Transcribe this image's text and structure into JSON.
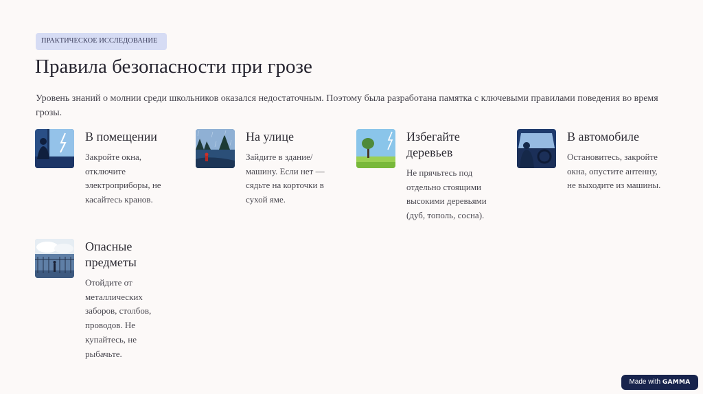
{
  "badge": "ПРАКТИЧЕСКОЕ ИССЛЕДОВАНИЕ",
  "title": "Правила безопасности при грозе",
  "intro": "Уровень знаний о молнии среди школьников оказался недостаточным. Поэтому была разработана памятка с ключевыми правилами поведения во время грозы.",
  "cards": [
    {
      "title": "В помещении",
      "text": "Закройте окна, отключите электроприборы, не касайтесь кранов.",
      "icon": "person-at-window-lightning-icon"
    },
    {
      "title": "На улице",
      "text": "Зайдите в здание/машину. Если нет — сядьте на корточки в сухой яме.",
      "icon": "person-outdoors-rain-icon"
    },
    {
      "title": "Избегайте деревьев",
      "text": "Не прячьтесь под отдельно стоящими высокими деревьями (дуб, тополь, сосна).",
      "icon": "lone-tree-lightning-icon"
    },
    {
      "title": "В автомобиле",
      "text": "Остановитесь, закройте окна, опустите антенну, не выходите из машины.",
      "icon": "driver-in-car-icon"
    },
    {
      "title": "Опасные предметы",
      "text": "Отойдите от металлических заборов, столбов, проводов. Не купайтесь, не рыбачьте.",
      "icon": "metal-fence-rain-icon"
    }
  ],
  "footer": {
    "made_with": "Made with",
    "brand": "GAMMA"
  },
  "colors": {
    "background": "#fcf9f8",
    "badge_bg": "#d6dcf4",
    "footer_bg": "#18244d"
  }
}
